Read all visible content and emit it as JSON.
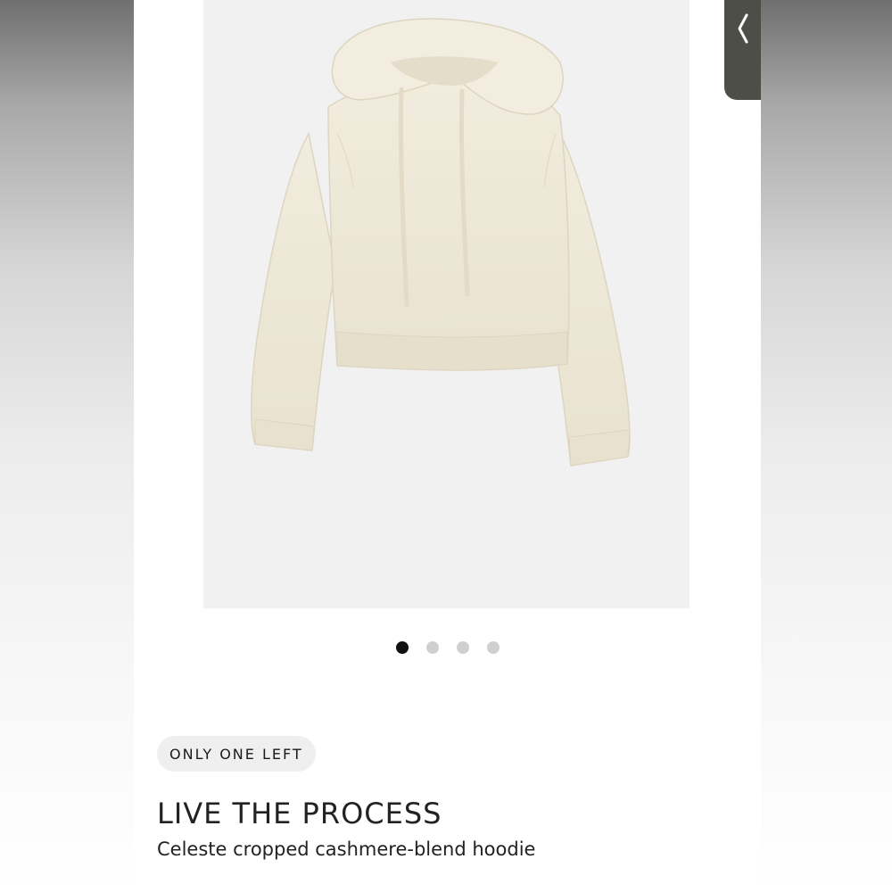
{
  "product": {
    "stock_badge": "ONLY ONE LEFT",
    "brand": "LIVE THE PROCESS",
    "name": "Celeste cropped cashmere-blend hoodie",
    "image_icon": "hoodie-product-photo",
    "garment_color": "#efe9da"
  },
  "carousel": {
    "total_images": 4,
    "active_index": 0
  },
  "side_tab": {
    "icon": "chevron-left-icon"
  },
  "colors": {
    "active_dot": "#111111",
    "inactive_dot": "#cfcfcf",
    "badge_bg": "#efefef",
    "side_tab_bg": "#4e4e49"
  }
}
